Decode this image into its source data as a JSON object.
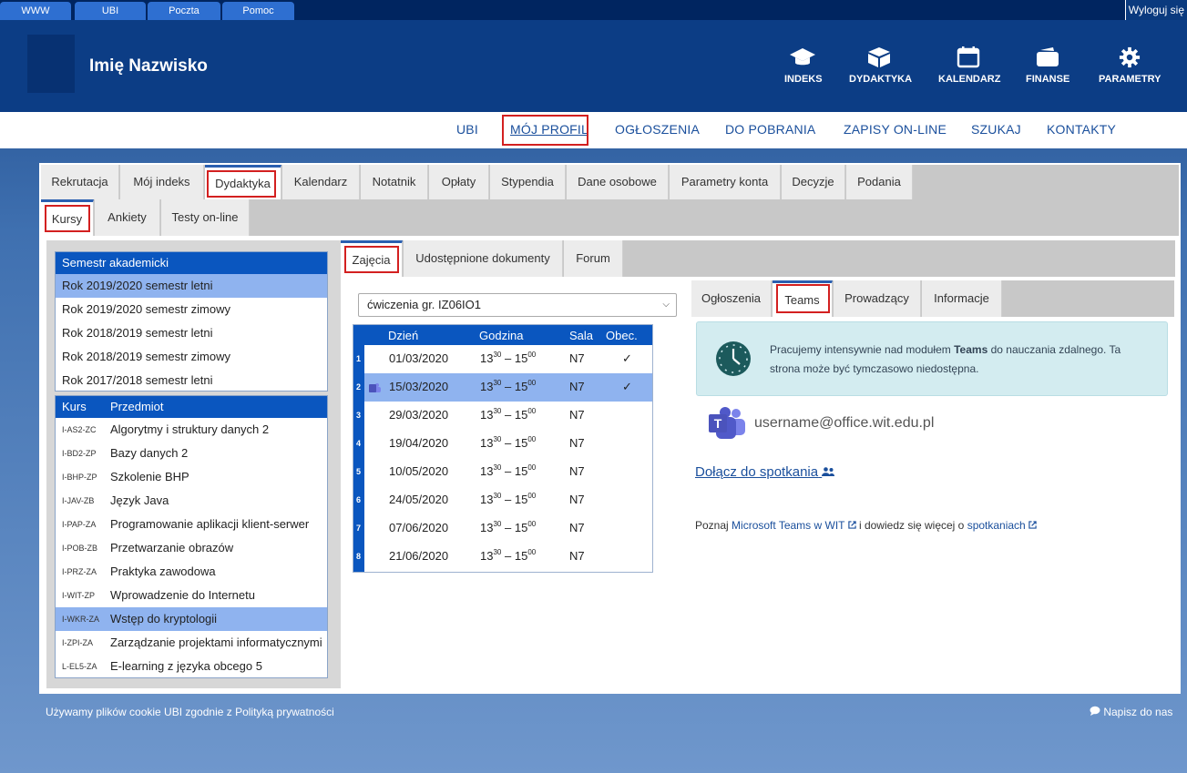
{
  "top_tabs": [
    "WWW",
    "UBI",
    "Poczta",
    "Pomoc"
  ],
  "logout_label": "Wyloguj się",
  "user_name": "Imię Nazwisko",
  "header_icons": [
    {
      "label": "INDEKS",
      "icon": "graduation-cap-icon"
    },
    {
      "label": "DYDAKTYKA",
      "icon": "cube-icon"
    },
    {
      "label": "KALENDARZ",
      "icon": "calendar-icon"
    },
    {
      "label": "FINANSE",
      "icon": "wallet-icon"
    },
    {
      "label": "PARAMETRY",
      "icon": "gear-icon"
    }
  ],
  "main_nav": [
    "UBI",
    "MÓJ PROFIL",
    "OGŁOSZENIA",
    "DO POBRANIA",
    "ZAPISY ON-LINE",
    "SZUKAJ",
    "KONTAKTY"
  ],
  "main_nav_active": "MÓJ PROFIL",
  "section_tabs": [
    "Rekrutacja",
    "Mój indeks",
    "Dydaktyka",
    "Kalendarz",
    "Notatnik",
    "Opłaty",
    "Stypendia",
    "Dane osobowe",
    "Parametry konta",
    "Decyzje",
    "Podania"
  ],
  "section_tab_active": "Dydaktyka",
  "sub_tabs": [
    "Kursy",
    "Ankiety",
    "Testy on-line"
  ],
  "sub_tab_active": "Kursy",
  "semesters": {
    "header": "Semestr akademicki",
    "items": [
      "Rok 2019/2020 semestr letni",
      "Rok 2019/2020 semestr zimowy",
      "Rok 2018/2019 semestr letni",
      "Rok 2018/2019 semestr zimowy",
      "Rok 2017/2018 semestr letni"
    ],
    "selected_index": 0
  },
  "courses": {
    "header_code": "Kurs",
    "header_name": "Przedmiot",
    "items": [
      {
        "code": "I-AS2-ZC",
        "name": "Algorytmy i struktury danych 2"
      },
      {
        "code": "I-BD2-ZP",
        "name": "Bazy danych 2"
      },
      {
        "code": "I-BHP-ZP",
        "name": "Szkolenie BHP"
      },
      {
        "code": "I-JAV-ZB",
        "name": "Język Java"
      },
      {
        "code": "I-PAP-ZA",
        "name": "Programowanie aplikacji klient-serwer"
      },
      {
        "code": "I-POB-ZB",
        "name": "Przetwarzanie obrazów"
      },
      {
        "code": "I-PRZ-ZA",
        "name": "Praktyka zawodowa"
      },
      {
        "code": "I-WIT-ZP",
        "name": "Wprowadzenie do Internetu"
      },
      {
        "code": "I-WKR-ZA",
        "name": "Wstęp do kryptologii"
      },
      {
        "code": "I-ZPI-ZA",
        "name": "Zarządzanie projektami informatycznymi"
      },
      {
        "code": "L-EL5-ZA",
        "name": "E-learning z języka obcego 5"
      }
    ],
    "selected_index": 8
  },
  "course_tabs": [
    "Zajęcia",
    "Udostępnione dokumenty",
    "Forum"
  ],
  "course_tab_active": "Zajęcia",
  "group_select": "ćwiczenia gr. IZ06IO1",
  "schedule": {
    "headers": [
      "Dzień",
      "Godzina",
      "Sala",
      "Obec."
    ],
    "time_start_h": "13",
    "time_start_m": "30",
    "time_sep": " – ",
    "time_end_h": "15",
    "time_end_m": "00",
    "rows": [
      {
        "n": "1",
        "date": "01/03/2020",
        "room": "N7",
        "check": "✓"
      },
      {
        "n": "2",
        "date": "15/03/2020",
        "room": "N7",
        "check": "✓"
      },
      {
        "n": "3",
        "date": "29/03/2020",
        "room": "N7",
        "check": ""
      },
      {
        "n": "4",
        "date": "19/04/2020",
        "room": "N7",
        "check": ""
      },
      {
        "n": "5",
        "date": "10/05/2020",
        "room": "N7",
        "check": ""
      },
      {
        "n": "6",
        "date": "24/05/2020",
        "room": "N7",
        "check": ""
      },
      {
        "n": "7",
        "date": "07/06/2020",
        "room": "N7",
        "check": ""
      },
      {
        "n": "8",
        "date": "21/06/2020",
        "room": "N7",
        "check": ""
      }
    ],
    "selected_index": 1
  },
  "info_tabs": [
    "Ogłoszenia",
    "Teams",
    "Prowadzący",
    "Informacje"
  ],
  "info_tab_active": "Teams",
  "alert": {
    "before": "Pracujemy intensywnie nad modułem ",
    "bold": "Teams",
    "after": " do nauczania zdalnego. Ta strona może być tymczasowo niedostępna."
  },
  "teams_email": "username@office.wit.edu.pl",
  "join_label": "Dołącz do spotkania",
  "learn": {
    "pre": "Poznaj ",
    "link1": "Microsoft Teams w WIT",
    "mid": " i dowiedz się więcej o ",
    "link2": "spotkaniach"
  },
  "footer_left_pre": "Używamy plików cookie UBI zgodnie z ",
  "footer_left_link": "Polityką prywatności",
  "footer_right": "Napisz do nas",
  "colors": {
    "accent": "#0a56bf",
    "header": "#0c3d85",
    "highlight": "#8fb3ef",
    "alert_bg": "#d3ecf0",
    "red_box": "#d32020"
  }
}
